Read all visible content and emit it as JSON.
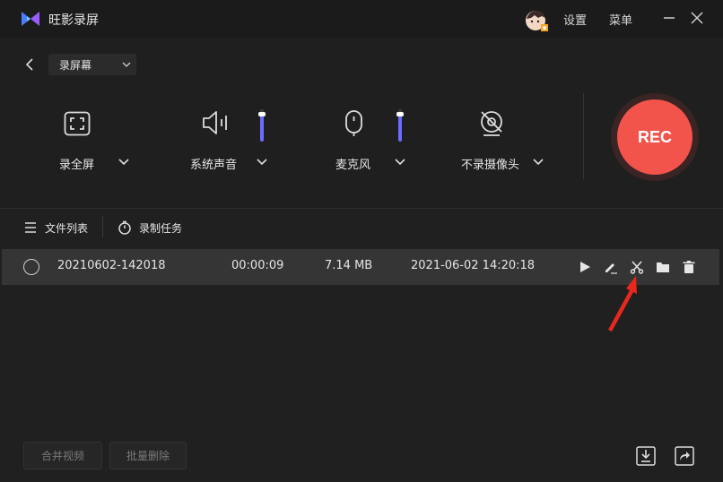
{
  "app": {
    "title": "旺影录屏",
    "settings_label": "设置",
    "menu_label": "菜单"
  },
  "toolbar": {
    "mode_select": "录屏幕"
  },
  "sources": [
    {
      "label": "录全屏",
      "icon": "fullscreen-icon"
    },
    {
      "label": "系统声音",
      "icon": "speaker-icon",
      "volume": 0.85
    },
    {
      "label": "麦克风",
      "icon": "microphone-icon",
      "volume": 0.85
    },
    {
      "label": "不录摄像头",
      "icon": "camera-off-icon"
    }
  ],
  "rec": {
    "label": "REC",
    "color": "#f2534a"
  },
  "tabs": [
    {
      "label": "文件列表",
      "icon": "list-icon"
    },
    {
      "label": "录制任务",
      "icon": "timer-icon"
    }
  ],
  "files": [
    {
      "name": "20210602-142018",
      "duration": "00:00:09",
      "size": "7.14 MB",
      "date": "2021-06-02 14:20:18",
      "actions": [
        "play-icon",
        "edit-icon",
        "scissors-icon",
        "folder-icon",
        "trash-icon"
      ]
    }
  ],
  "footer": {
    "merge_label": "合并视频",
    "batch_delete_label": "批量删除"
  },
  "colors": {
    "accent": "#6b6bff",
    "rec": "#f2534a",
    "annotation": "#e8281e"
  }
}
